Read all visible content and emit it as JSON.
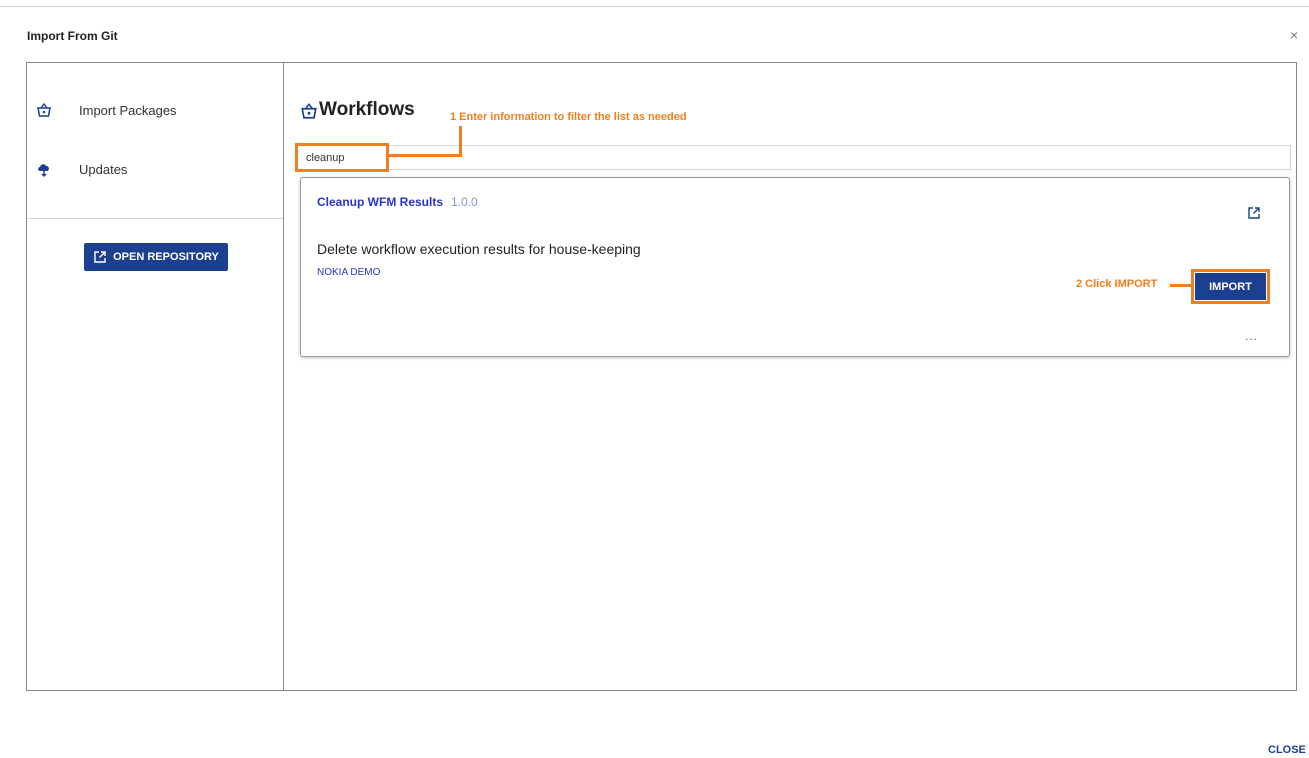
{
  "dialog": {
    "title": "Import From Git",
    "close_symbol": "×",
    "close_label": "CLOSE"
  },
  "sidebar": {
    "items": [
      {
        "label": "Import Packages",
        "icon": "basket-icon"
      },
      {
        "label": "Updates",
        "icon": "cloud-download-icon"
      }
    ],
    "open_repository_label": "OPEN REPOSITORY"
  },
  "main": {
    "section_title": "Workflows",
    "search": {
      "value": "cleanup",
      "placeholder": ""
    },
    "cards": [
      {
        "title": "Cleanup WFM Results",
        "version": "1.0.0",
        "description": "Delete workflow execution results for house-keeping",
        "tag": "NOKIA DEMO",
        "import_label": "IMPORT",
        "more_label": "..."
      }
    ]
  },
  "annotations": {
    "step1": "1 Enter information to filter the list as needed",
    "step2": "2 Click IMPORT"
  },
  "colors": {
    "accent": "#1d3f8f",
    "link": "#2a35c8",
    "annotation": "#f07f1f"
  }
}
